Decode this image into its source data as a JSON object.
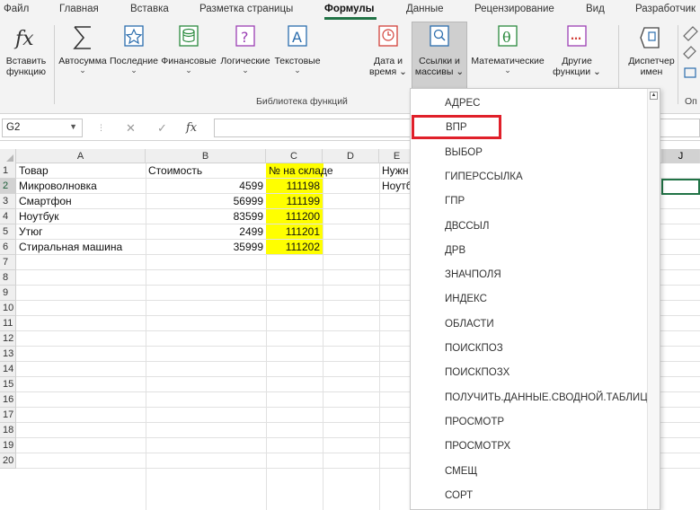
{
  "ribbon_tabs": [
    "Файл",
    "Главная",
    "Вставка",
    "Разметка страницы",
    "Формулы",
    "Данные",
    "Рецензирование",
    "Вид",
    "Разработчик"
  ],
  "active_tab": "Формулы",
  "ribbon_buttons": {
    "insert_function": {
      "line1": "Вставить",
      "line2": "функцию",
      "icon": "fx-icon"
    },
    "autosum": {
      "label": "Автосумма",
      "icon": "sigma-icon"
    },
    "recent": {
      "label": "Последние",
      "icon": "star-icon"
    },
    "financial": {
      "label": "Финансовые",
      "icon": "database-icon"
    },
    "logical": {
      "label": "Логические",
      "icon": "question-icon"
    },
    "text": {
      "label": "Текстовые",
      "icon": "text-a-icon"
    },
    "datetime": {
      "line1": "Дата и",
      "line2": "время",
      "icon": "clock-icon"
    },
    "lookup": {
      "line1": "Ссылки и",
      "line2": "массивы",
      "icon": "magnifier-icon"
    },
    "math": {
      "label": "Математические",
      "icon": "theta-icon"
    },
    "more": {
      "line1": "Другие",
      "line2": "функции",
      "icon": "more-icon"
    },
    "name_manager": {
      "line1": "Диспетчер",
      "line2": "имен",
      "icon": "name-tag-icon"
    }
  },
  "ribbon_groups": {
    "library": "Библиотека функций",
    "next": "Оп"
  },
  "formula_bar": {
    "name_box": "G2",
    "fx": "fx",
    "value": ""
  },
  "columns": [
    "A",
    "B",
    "C",
    "D",
    "E",
    "J"
  ],
  "rows": [
    {
      "n": "1",
      "a": "Товар",
      "b": "Стоимость",
      "c": "№ на складе",
      "e": "Нужн"
    },
    {
      "n": "2",
      "a": "Микроволновка",
      "b": "4599",
      "c": "111198",
      "e": "Ноутб"
    },
    {
      "n": "3",
      "a": "Смартфон",
      "b": "56999",
      "c": "111199",
      "e": ""
    },
    {
      "n": "4",
      "a": "Ноутбук",
      "b": "83599",
      "c": "111200",
      "e": ""
    },
    {
      "n": "5",
      "a": "Утюг",
      "b": "2499",
      "c": "111201",
      "e": ""
    },
    {
      "n": "6",
      "a": "Стиральная машина",
      "b": "35999",
      "c": "111202",
      "e": ""
    },
    {
      "n": "7"
    },
    {
      "n": "8"
    },
    {
      "n": "9"
    },
    {
      "n": "10"
    },
    {
      "n": "11"
    },
    {
      "n": "12"
    },
    {
      "n": "13"
    },
    {
      "n": "14"
    },
    {
      "n": "15"
    },
    {
      "n": "16"
    },
    {
      "n": "17"
    },
    {
      "n": "18"
    },
    {
      "n": "19"
    },
    {
      "n": "20"
    }
  ],
  "dropdown_items": [
    "АДРЕС",
    "ВПР",
    "ВЫБОР",
    "ГИПЕРССЫЛКА",
    "ГПР",
    "ДВССЫЛ",
    "ДРВ",
    "ЗНАЧПОЛЯ",
    "ИНДЕКС",
    "ОБЛАСТИ",
    "ПОИСКПОЗ",
    "ПОИСКПОЗХ",
    "ПОЛУЧИТЬ.ДАННЫЕ.СВОДНОЙ.ТАБЛИЦЫ",
    "ПРОСМОТР",
    "ПРОСМОТРХ",
    "СМЕЩ",
    "СОРТ"
  ],
  "highlighted_item": "ВПР",
  "colors": {
    "accent": "#217346",
    "highlight_cell": "#ffff00",
    "callout": "#e0202a"
  }
}
